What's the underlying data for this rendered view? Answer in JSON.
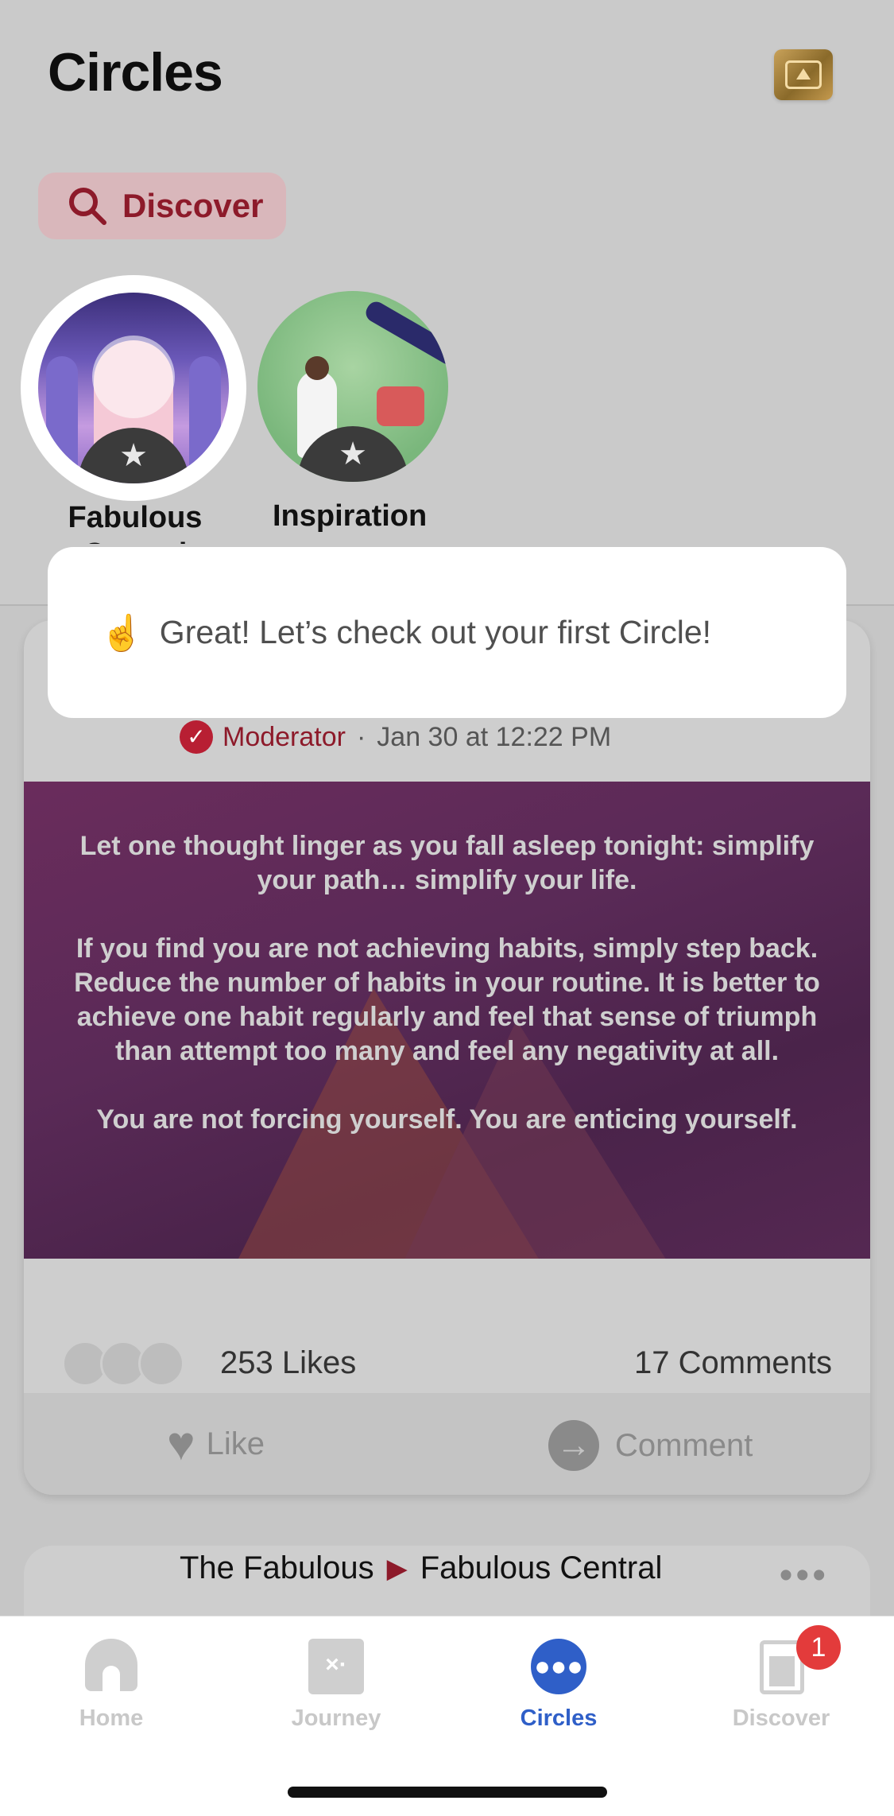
{
  "header": {
    "title": "Circles",
    "premium_icon": "premium-frame-icon"
  },
  "discover_chip": {
    "label": "Discover",
    "icon": "search-icon",
    "color": "#8d1a2a"
  },
  "circles": [
    {
      "label_line1": "Fabulous",
      "label_line2": "Central",
      "selected": true
    },
    {
      "label_line1": "Inspiration",
      "selected": false
    }
  ],
  "tooltip": {
    "emoji": "☝️",
    "message": "Great! Let’s check out your first Circle!"
  },
  "post": {
    "role": "Moderator",
    "separator": "·",
    "date": "Jan 30 at 12:22 PM",
    "quote": {
      "p1": "Let one thought linger as you fall asleep tonight: simplify your path… simplify your life.",
      "p2": "If you find you are not achieving habits, simply step back. Reduce the number of habits in your routine. It is better to achieve one habit regularly and feel that sense of triumph than attempt too many and feel any negativity at all.",
      "p3": "You are not forcing yourself. You are enticing yourself."
    },
    "likes": "253 Likes",
    "comments": "17 Comments",
    "like_label": "Like",
    "comment_label": "Comment"
  },
  "next_post": {
    "source": "The Fabulous",
    "circle": "Fabulous Central"
  },
  "tabbar": {
    "active_color": "#2f5fc8",
    "tabs": [
      {
        "label": "Home",
        "icon": "home-icon"
      },
      {
        "label": "Journey",
        "icon": "map-icon"
      },
      {
        "label": "Circles",
        "icon": "people-icon"
      },
      {
        "label": "Discover",
        "icon": "document-icon",
        "badge": "1"
      }
    ]
  }
}
